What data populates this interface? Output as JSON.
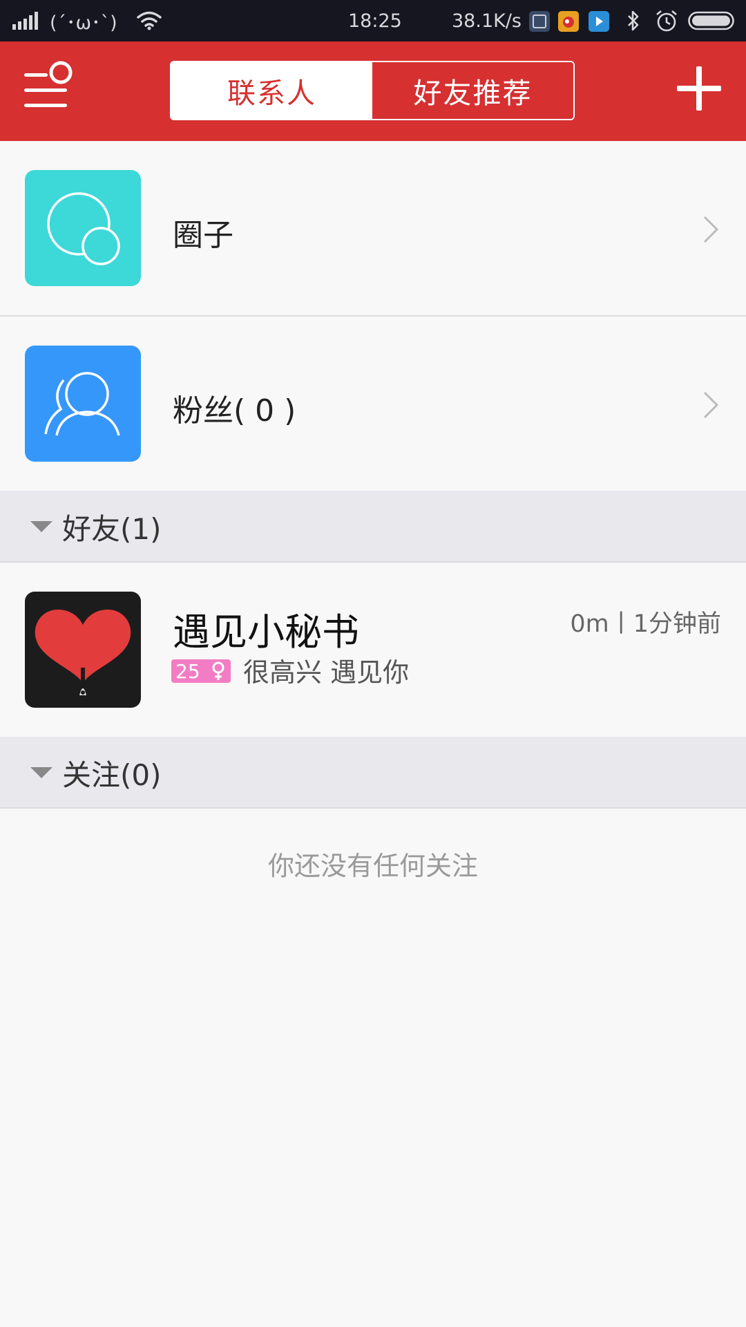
{
  "status_bar": {
    "kaomoji": "(´･ω･`)",
    "time": "18:25",
    "network_speed": "38.1K/s"
  },
  "header": {
    "tabs": [
      {
        "label": "联系人",
        "active": true
      },
      {
        "label": "好友推荐",
        "active": false
      }
    ],
    "accent_color": "#d63031"
  },
  "list": {
    "circle": {
      "label": "圈子"
    },
    "fans": {
      "label": "粉丝( 0 )"
    }
  },
  "friends_section": {
    "title": "好友(1)",
    "items": [
      {
        "name": "遇见小秘书",
        "meta": "0m丨1分钟前",
        "age": "25",
        "gender": "female",
        "signature": "很高兴 遇见你"
      }
    ]
  },
  "following_section": {
    "title": "关注(0)",
    "empty_text": "你还没有任何关注"
  },
  "icons": [
    "signal-icon",
    "wifi-icon",
    "notification-app-icons",
    "bluetooth-icon",
    "alarm-icon",
    "battery-icon",
    "menu-icon",
    "add-icon",
    "circle-group-icon",
    "fans-icon",
    "heart-avatar",
    "chevron-right-icon",
    "triangle-down-icon"
  ]
}
